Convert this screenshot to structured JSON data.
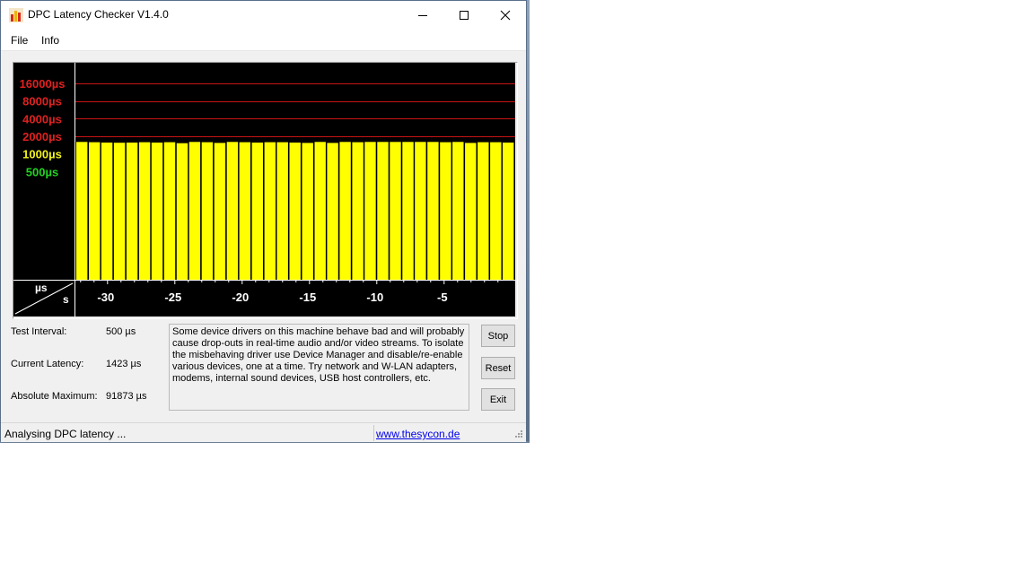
{
  "window": {
    "title": "DPC Latency Checker V1.4.0"
  },
  "menu": {
    "items": [
      "File",
      "Info"
    ]
  },
  "chart_data": {
    "type": "bar",
    "y_axis_labels": [
      {
        "label": "16000µs",
        "color": "#e02020"
      },
      {
        "label": "8000µs",
        "color": "#e02020"
      },
      {
        "label": "4000µs",
        "color": "#e02020"
      },
      {
        "label": "2000µs",
        "color": "#e02020"
      },
      {
        "label": "1000µs",
        "color": "#f2f21a"
      },
      {
        "label": "500µs",
        "color": "#21d321"
      }
    ],
    "gridline_values_us": [
      16000,
      8000,
      4000,
      2000
    ],
    "x_tick_labels": [
      "-30",
      "-25",
      "-20",
      "-15",
      "-10",
      "-5"
    ],
    "x_ticks_s": [
      -30,
      -25,
      -20,
      -15,
      -10,
      -5
    ],
    "corner_units": {
      "y": "µs",
      "x": "s"
    },
    "bar_values_us": [
      1600,
      1580,
      1560,
      1550,
      1560,
      1580,
      1560,
      1580,
      1520,
      1600,
      1580,
      1540,
      1600,
      1580,
      1560,
      1580,
      1580,
      1560,
      1540,
      1600,
      1540,
      1600,
      1580,
      1600,
      1600,
      1600,
      1600,
      1600,
      1600,
      1580,
      1600,
      1540,
      1580,
      1580,
      1560
    ],
    "bar_color": "#ffff00",
    "background": "#000000"
  },
  "info": {
    "test_interval_label": "Test Interval:",
    "test_interval_value": "500 µs",
    "current_latency_label": "Current Latency:",
    "current_latency_value": "1423 µs",
    "absolute_maximum_label": "Absolute Maximum:",
    "absolute_maximum_value": "91873 µs"
  },
  "message": "Some device drivers on this machine behave bad and will probably cause drop-outs in real-time audio and/or video streams. To isolate the misbehaving driver use Device Manager and disable/re-enable various devices, one at a time. Try network and W-LAN adapters, modems, internal sound devices, USB host controllers, etc.",
  "buttons": {
    "stop": "Stop",
    "reset": "Reset",
    "exit": "Exit"
  },
  "status": {
    "text": "Analysing DPC latency ...",
    "link": "www.thesycon.de"
  }
}
